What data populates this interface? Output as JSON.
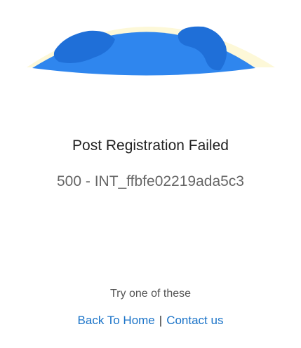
{
  "error": {
    "title": "Post Registration Failed",
    "code": "500 - INT_ffbfe02219ada5c3"
  },
  "help": {
    "hint": "Try one of these",
    "links": [
      {
        "label": "Back To Home"
      },
      {
        "label": "Contact us"
      }
    ],
    "separator": "|"
  },
  "colors": {
    "globe_ocean": "#2f86ee",
    "globe_land": "#1f6fd8",
    "globe_glow": "#fdf8d8",
    "link": "#1a73c8"
  },
  "icons": {
    "illustration": "globe-illustration-icon"
  }
}
